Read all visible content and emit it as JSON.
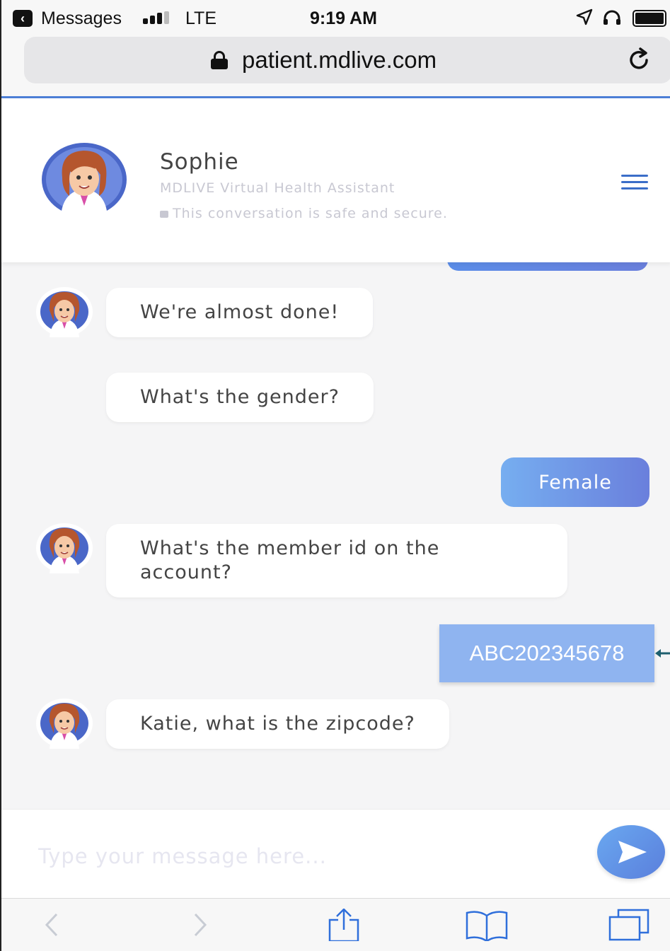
{
  "status_bar": {
    "back_app": "Messages",
    "carrier": "LTE",
    "time": "9:19 AM"
  },
  "browser": {
    "url": "patient.mdlive.com",
    "icons": [
      "lock-icon",
      "reload-icon"
    ]
  },
  "chat_header": {
    "agent_name": "Sophie",
    "agent_role": "MDLIVE Virtual Health Assistant",
    "security_note": "This conversation is safe and secure."
  },
  "messages": [
    {
      "from": "assistant",
      "text": "We're almost done!"
    },
    {
      "from": "assistant",
      "text": "What's the gender?"
    },
    {
      "from": "user",
      "text": "Female"
    },
    {
      "from": "assistant",
      "text": "What's the member id on the account?"
    },
    {
      "from": "user",
      "text": "ABC202345678"
    },
    {
      "from": "assistant",
      "text": "Katie, what is the zipcode?"
    }
  ],
  "composer": {
    "placeholder": "Type your message here...",
    "value": ""
  },
  "toolbar": {
    "icons": [
      "back-icon",
      "forward-icon",
      "share-icon",
      "bookmarks-icon",
      "tabs-icon"
    ]
  },
  "colors": {
    "accent": "#4d7fd6",
    "user_bubble_start": "#76aef0",
    "user_bubble_end": "#6a7fdc",
    "chat_background": "#f5f5f6"
  }
}
